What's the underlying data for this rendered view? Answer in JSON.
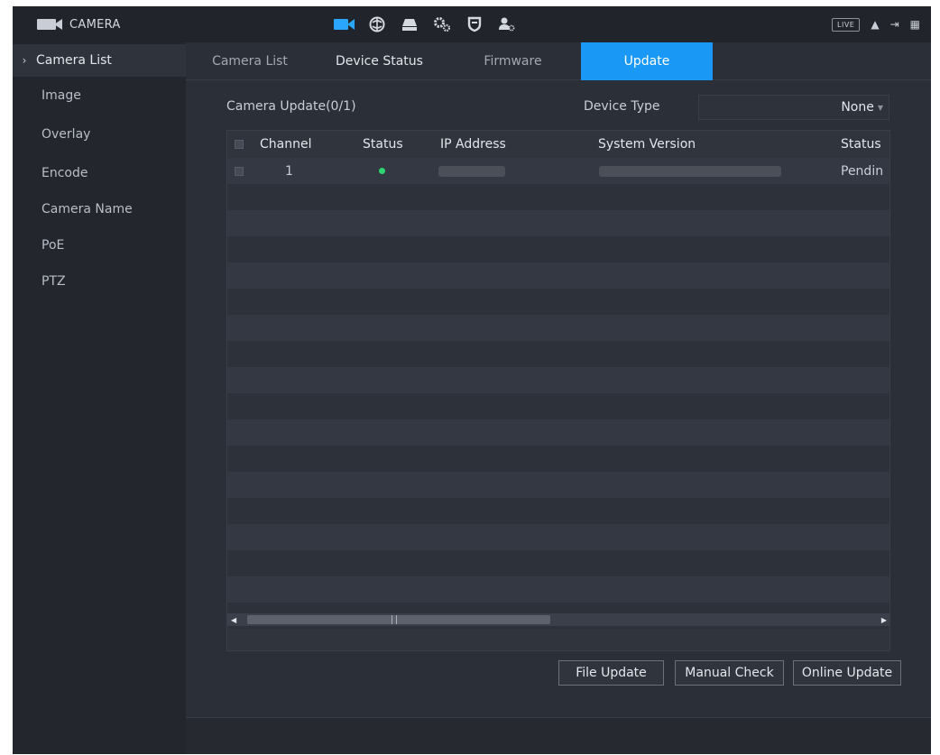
{
  "app": {
    "title": "CAMERA",
    "live_label": "LIVE"
  },
  "sidebar": {
    "items": [
      {
        "label": "Camera List",
        "active": true
      },
      {
        "label": "Image"
      },
      {
        "label": "Overlay"
      },
      {
        "label": "Encode"
      },
      {
        "label": "Camera Name"
      },
      {
        "label": "PoE"
      },
      {
        "label": "PTZ"
      }
    ]
  },
  "tabs": [
    {
      "label": "Camera List"
    },
    {
      "label": "Device Status"
    },
    {
      "label": "Firmware"
    },
    {
      "label": "Update",
      "active": true
    }
  ],
  "update": {
    "camera_update_label": "Camera Update(0/1)",
    "device_type_label": "Device Type",
    "device_type_value": "None"
  },
  "table": {
    "columns": [
      "Channel",
      "Status",
      "IP Address",
      "System Version",
      "Status"
    ],
    "rows": [
      {
        "channel": "1",
        "status": "online",
        "ip_address": "",
        "system_version": "",
        "update_status": "Pendin"
      }
    ]
  },
  "buttons": {
    "file_update": "File Update",
    "manual_check": "Manual Check",
    "online_update": "Online Update"
  },
  "icons": {
    "brand": "camera-icon",
    "nav": [
      "camera-icon",
      "network-icon",
      "storage-icon",
      "system-icon",
      "security-icon",
      "account-icon"
    ],
    "top_right": [
      "user-icon",
      "logout-icon",
      "grid-icon"
    ]
  },
  "colors": {
    "accent": "#1a98f5",
    "online": "#2ed573"
  }
}
